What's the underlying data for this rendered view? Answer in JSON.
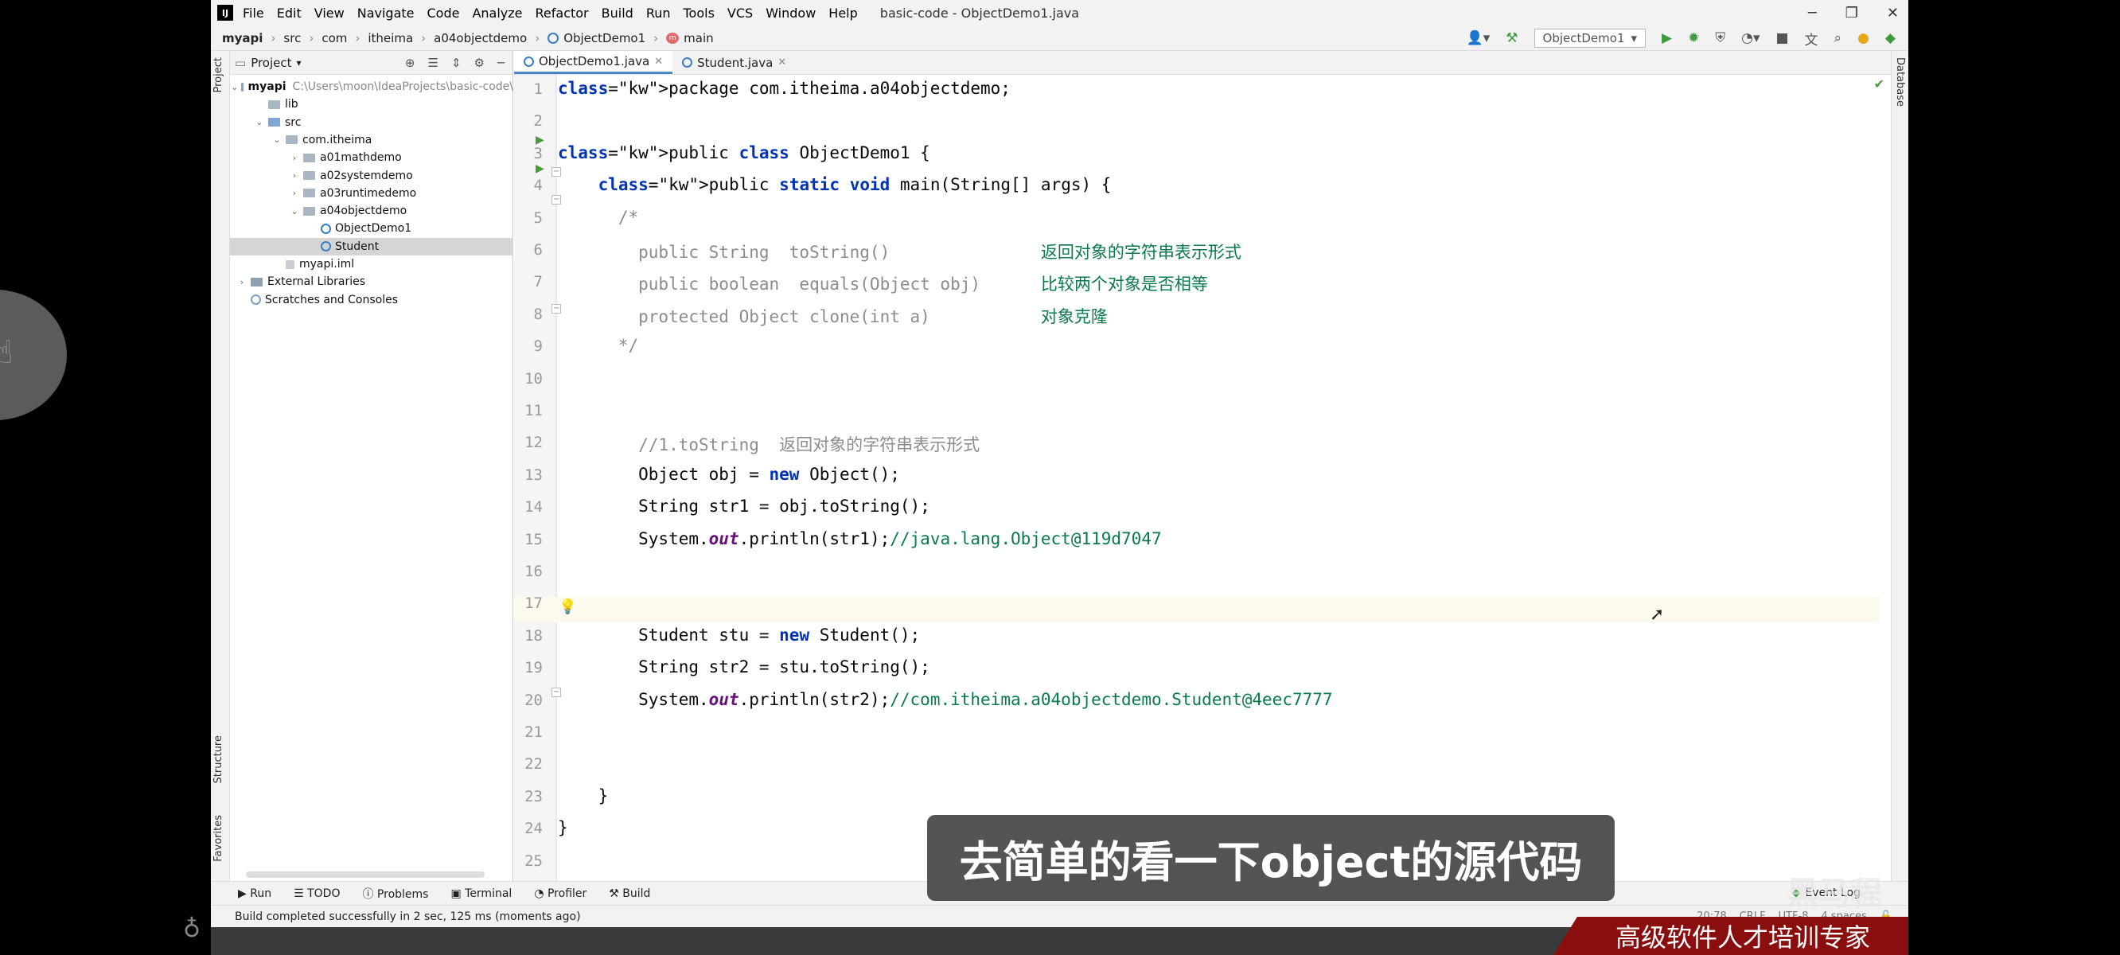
{
  "window": {
    "logo": "IJ",
    "title": "basic-code - ObjectDemo1.java",
    "menu": [
      "File",
      "Edit",
      "View",
      "Navigate",
      "Code",
      "Analyze",
      "Refactor",
      "Build",
      "Run",
      "Tools",
      "VCS",
      "Window",
      "Help"
    ]
  },
  "breadcrumb": [
    "myapi",
    "src",
    "com",
    "itheima",
    "a04objectdemo",
    "ObjectDemo1",
    "main"
  ],
  "run_config": "ObjectDemo1",
  "project_panel": {
    "title": "Project",
    "tree": [
      {
        "label": "myapi",
        "path": "C:\\Users\\moon\\IdeaProjects\\basic-code\\",
        "indent": 0,
        "arrow": "v",
        "icon": "folder-blue",
        "bold": true
      },
      {
        "label": "lib",
        "indent": 1,
        "arrow": "",
        "icon": "folder"
      },
      {
        "label": "src",
        "indent": 1,
        "arrow": "v",
        "icon": "folder-blue"
      },
      {
        "label": "com.itheima",
        "indent": 2,
        "arrow": "v",
        "icon": "folder"
      },
      {
        "label": "a01mathdemo",
        "indent": 3,
        "arrow": ">",
        "icon": "folder"
      },
      {
        "label": "a02systemdemo",
        "indent": 3,
        "arrow": ">",
        "icon": "folder"
      },
      {
        "label": "a03runtimedemo",
        "indent": 3,
        "arrow": ">",
        "icon": "folder"
      },
      {
        "label": "a04objectdemo",
        "indent": 3,
        "arrow": "v",
        "icon": "folder"
      },
      {
        "label": "ObjectDemo1",
        "indent": 4,
        "arrow": "",
        "icon": "class"
      },
      {
        "label": "Student",
        "indent": 4,
        "arrow": "",
        "icon": "class",
        "selected": true
      },
      {
        "label": "myapi.iml",
        "indent": 2,
        "arrow": "",
        "icon": "file"
      },
      {
        "label": "External Libraries",
        "indent": 0,
        "arrow": ">",
        "icon": "library"
      },
      {
        "label": "Scratches and Consoles",
        "indent": 0,
        "arrow": "",
        "icon": "scratch"
      }
    ]
  },
  "side_tabs": {
    "project": "Project",
    "structure": "Structure",
    "favorites": "Favorites",
    "database": "Database"
  },
  "editor_tabs": [
    {
      "label": "ObjectDemo1.java",
      "active": true
    },
    {
      "label": "Student.java",
      "active": false
    }
  ],
  "code_lines": [
    "package com.itheima.a04objectdemo;",
    "",
    "public class ObjectDemo1 {",
    "    public static void main(String[] args) {",
    "      /*",
    "        public String  toString()               返回对象的字符串表示形式",
    "        public boolean  equals(Object obj)      比较两个对象是否相等",
    "        protected Object clone(int a)           对象克隆",
    "      */",
    "",
    "",
    "        //1.toString  返回对象的字符串表示形式",
    "        Object obj = new Object();",
    "        String str1 = obj.toString();",
    "        System.out.println(str1);//java.lang.Object@119d7047",
    "",
    "",
    "        Student stu = new Student();",
    "        String str2 = stu.toString();",
    "        System.out.println(str2);//com.itheima.a04objectdemo.Student@4eec7777",
    "",
    "",
    "    }",
    "}",
    ""
  ],
  "tool_windows": [
    "Run",
    "TODO",
    "Problems",
    "Terminal",
    "Profiler",
    "Build"
  ],
  "event_log": "Event Log",
  "status": "Build completed successfully in 2 sec, 125 ms (moments ago)",
  "status_right": [
    "20:78",
    "CRLF",
    "UTF-8",
    "4 spaces"
  ],
  "subtitle": "去简单的看一下object的源代码",
  "banner": "高级软件人才培训专家",
  "watermark": "黑马程序员"
}
